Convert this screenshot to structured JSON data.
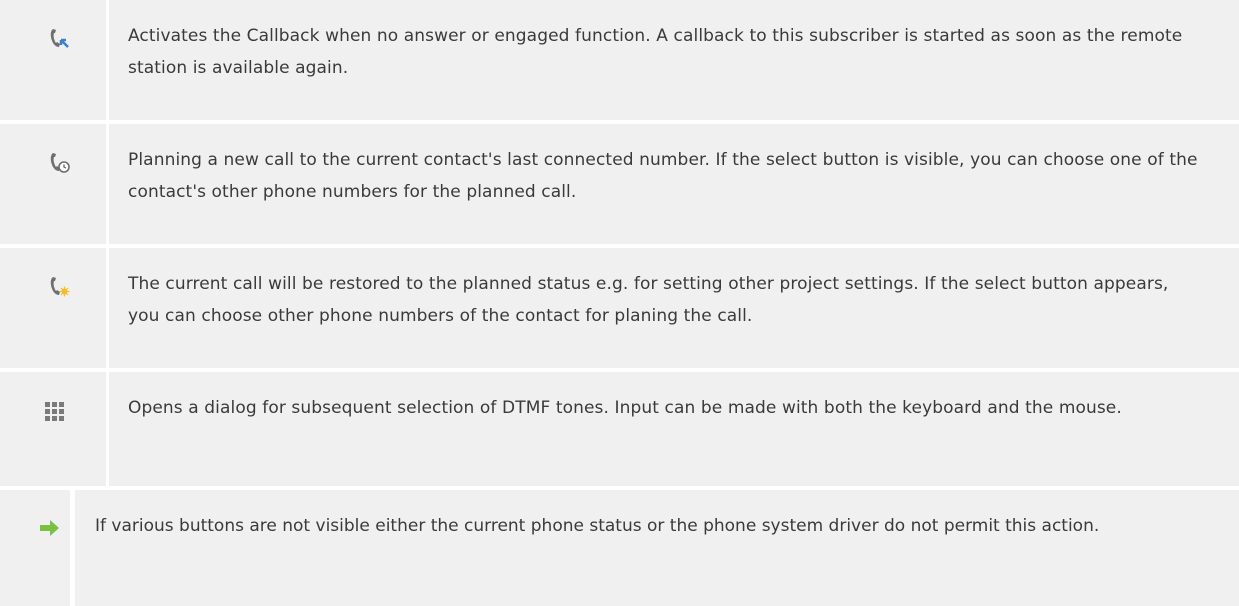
{
  "rows": [
    {
      "icon": "callback-phone-icon",
      "text": "Activates the Callback when no answer or engaged function. A callback to this subscriber is started as soon as the remote station is available again."
    },
    {
      "icon": "plan-call-phone-icon",
      "text": "Planning a new call to the current contact's last connected number. If the select button is visible, you can choose one of the contact's other phone numbers for the planned call."
    },
    {
      "icon": "restore-call-phone-icon",
      "text": "The current call will be restored to the planned status e.g. for setting other project settings. If the select button appears, you can choose other phone numbers of the contact for planing the call."
    },
    {
      "icon": "dtmf-keypad-icon",
      "text": "Opens a dialog for subsequent selection of DTMF tones. Input can be made with both the keyboard and the mouse."
    }
  ],
  "note": {
    "icon": "green-arrow-icon",
    "text": "If various buttons are not visible either the current phone status or the phone system driver do not permit this action."
  },
  "colors": {
    "row_bg": "#f0f0f0",
    "text": "#3a3a3a",
    "arrow": "#7ac142",
    "icon_grey": "#7a7a7a",
    "accent_blue": "#3b7fd0",
    "accent_yellow": "#f5c01e"
  }
}
